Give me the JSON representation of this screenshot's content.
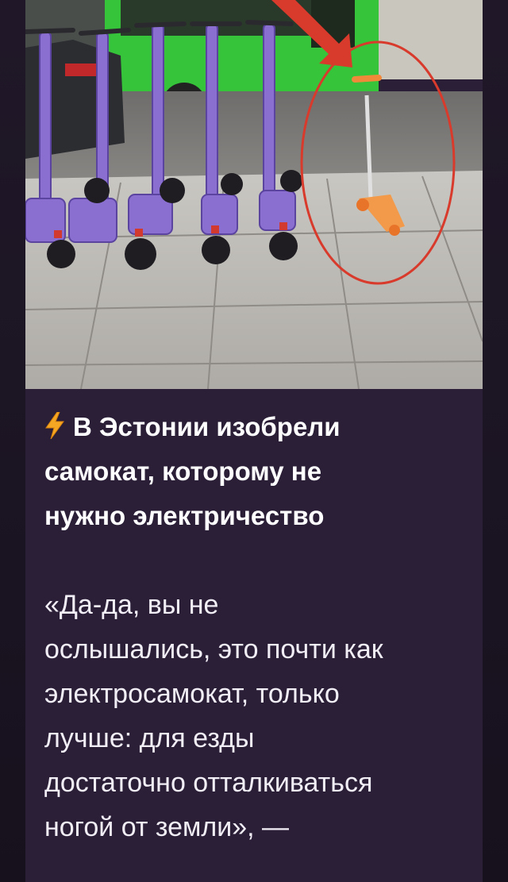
{
  "post": {
    "photo": {
      "icon": "street-scooters-photo",
      "highlight_color": "#d83a2c"
    },
    "headline_icon": "lightning-bolt-icon",
    "headline_lines": [
      "В Эстонии изобрели",
      "самокат, которому не",
      "нужно электричество"
    ],
    "body_lines": [
      "«Да-да, вы не",
      "ослышались, это почти как",
      "электросамокат, только",
      "лучше: для езды",
      "достаточно отталкиваться",
      "ногой от земли», —"
    ]
  },
  "colors": {
    "bubble": "#2b1f38",
    "text": "#ffffff",
    "accent_bolt": "#f5a623"
  }
}
